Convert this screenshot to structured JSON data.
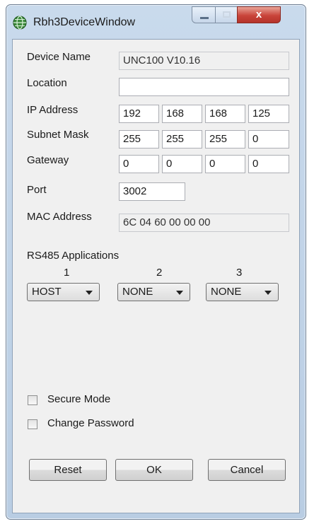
{
  "window": {
    "title": "Rbh3DeviceWindow",
    "close_glyph": "x"
  },
  "form": {
    "device_name": {
      "label": "Device Name",
      "value": "UNC100 V10.16"
    },
    "location": {
      "label": "Location",
      "value": ""
    },
    "ip_address": {
      "label": "IP Address",
      "octets": [
        "192",
        "168",
        "168",
        "125"
      ]
    },
    "subnet_mask": {
      "label": "Subnet Mask",
      "octets": [
        "255",
        "255",
        "255",
        "0"
      ]
    },
    "gateway": {
      "label": "Gateway",
      "octets": [
        "0",
        "0",
        "0",
        "0"
      ]
    },
    "port": {
      "label": "Port",
      "value": "3002"
    },
    "mac_address": {
      "label": "MAC Address",
      "value": "6C 04 60 00 00 00"
    }
  },
  "rs485": {
    "label": "RS485 Applications",
    "columns": [
      {
        "number": "1",
        "selected": "HOST"
      },
      {
        "number": "2",
        "selected": "NONE"
      },
      {
        "number": "3",
        "selected": "NONE"
      }
    ]
  },
  "options": {
    "secure_mode": {
      "label": "Secure Mode",
      "checked": false
    },
    "change_password": {
      "label": "Change Password",
      "checked": false
    }
  },
  "buttons": {
    "reset": "Reset",
    "ok": "OK",
    "cancel": "Cancel"
  },
  "icons": {
    "app": "globe-network-icon",
    "minimize": "minimize-icon",
    "maximize": "maximize-icon",
    "close": "close-icon",
    "dropdown": "chevron-down-icon"
  },
  "colors": {
    "title_bar": "#c9daec",
    "close_button": "#c9443a",
    "client_bg": "#f0f0f0"
  }
}
